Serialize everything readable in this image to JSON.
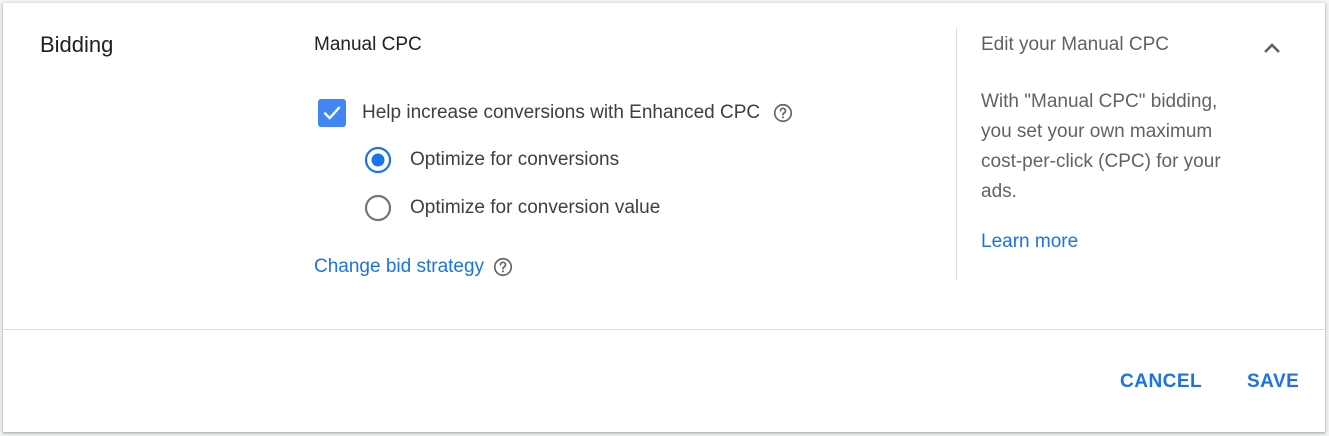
{
  "section": {
    "label": "Bidding"
  },
  "strategy": {
    "name": "Manual CPC",
    "ecpc": {
      "label": "Help increase conversions with Enhanced CPC",
      "checked": true
    },
    "options": [
      {
        "label": "Optimize for conversions",
        "selected": true
      },
      {
        "label": "Optimize for conversion value",
        "selected": false
      }
    ],
    "change_link": "Change bid strategy"
  },
  "help_panel": {
    "title": "Edit your Manual CPC",
    "body": "With \"Manual CPC\" bidding, you set your own maximum cost-per-click (CPC) for your ads.",
    "learn_more": "Learn more"
  },
  "footer": {
    "cancel_label": "CANCEL",
    "save_label": "SAVE"
  },
  "icons": {
    "help": "help-circle-icon",
    "collapse": "chevron-up-icon",
    "check": "check-icon"
  },
  "colors": {
    "accent": "#1a73e8",
    "checkbox": "#4285f4",
    "radio_unselected": "#757575"
  }
}
